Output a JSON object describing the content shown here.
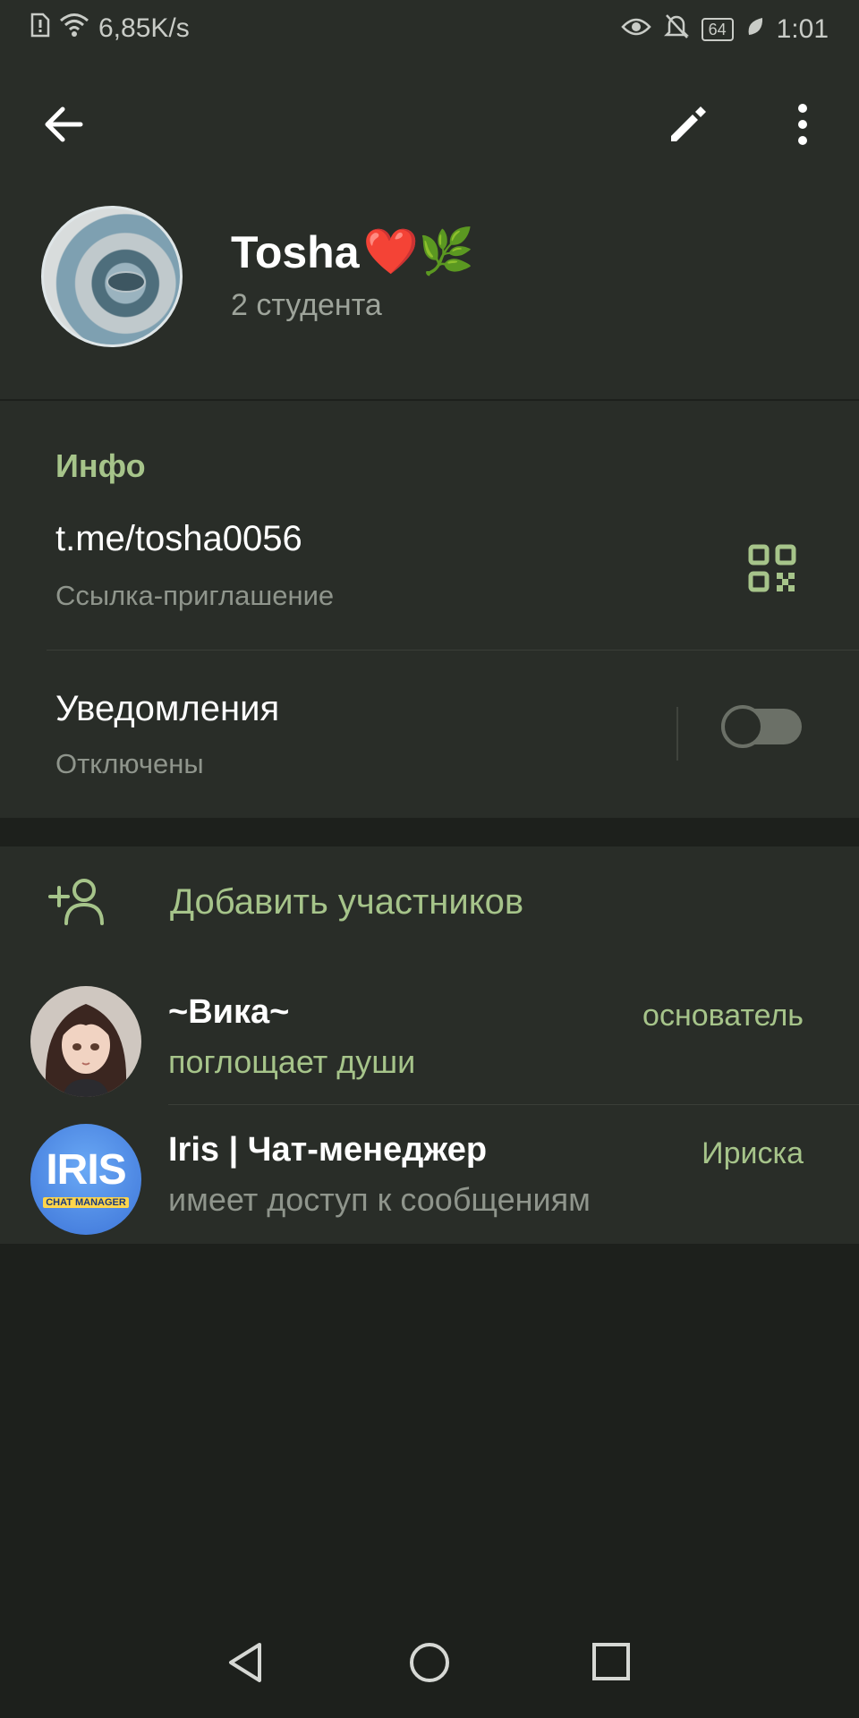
{
  "status_bar": {
    "speed": "6,85K/s",
    "battery": "64",
    "time": "1:01"
  },
  "header": {
    "group_name": "Tosha",
    "name_emoji": "❤️🌿",
    "members_count": "2 студента"
  },
  "info": {
    "section_title": "Инфо",
    "link": "t.me/tosha0056",
    "link_label": "Ссылка-приглашение",
    "notifications_title": "Уведомления",
    "notifications_state": "Отключены",
    "notifications_enabled": false
  },
  "members": {
    "add_label": "Добавить участников",
    "list": [
      {
        "name": "~Вика~",
        "status": "поглощает души",
        "role": "основатель",
        "status_color": "#a6c48a"
      },
      {
        "name": "Iris | Чат-менеджер",
        "status": "имеет доступ к сообщениям",
        "role": "Ириска",
        "status_color": "#8f958c",
        "avatar_text": "IRIS",
        "avatar_subtext": "CHAT MANAGER"
      }
    ]
  },
  "colors": {
    "accent": "#a6c48a",
    "surface": "#292d28",
    "background": "#1d201c"
  }
}
